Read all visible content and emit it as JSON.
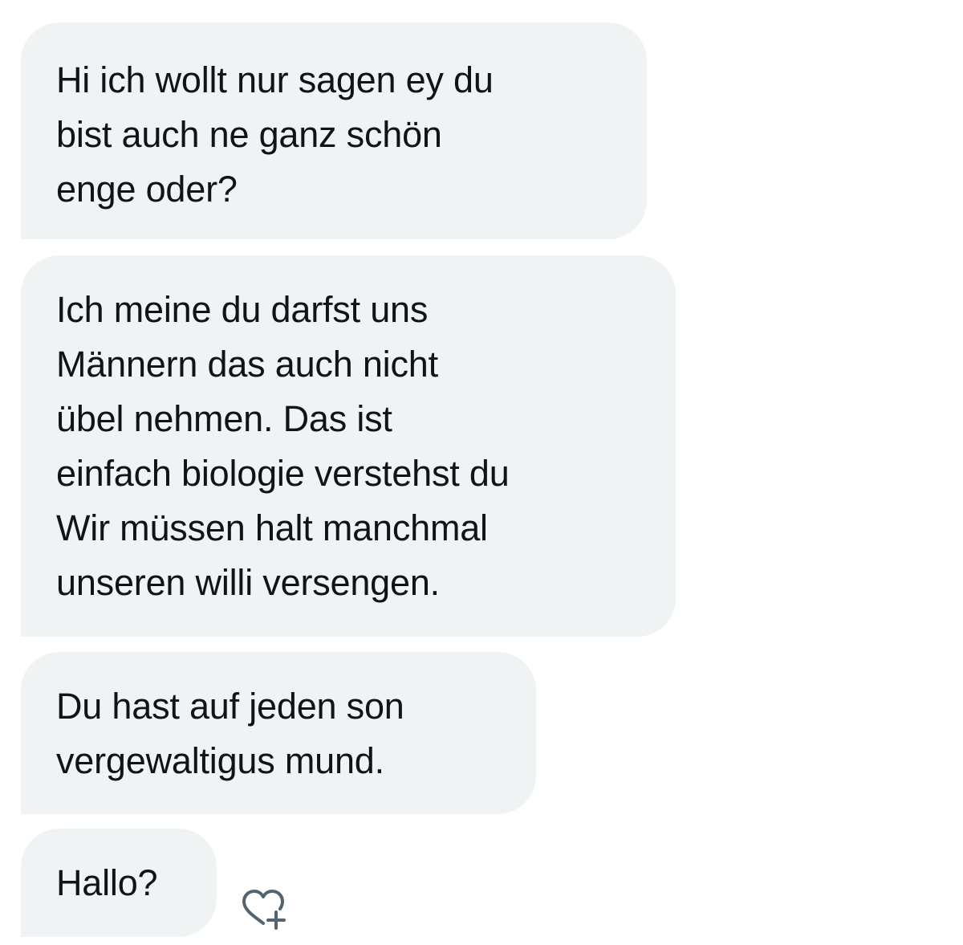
{
  "messages": [
    {
      "text": "Hi ich wollt nur sagen ey du\nbist auch ne ganz schön\nenge oder?"
    },
    {
      "text": "Ich meine du darfst uns\nMännern das auch nicht\nübel nehmen. Das ist\neinfach biologie verstehst du\nWir müssen halt manchmal\nunseren willi versengen."
    },
    {
      "text": "Du hast auf jeden son\nvergewaltigus mund."
    },
    {
      "text": "Hallo?"
    }
  ],
  "reaction_button": {
    "icon": "heart-plus-icon",
    "color": "#536471"
  },
  "colors": {
    "bubble_bg": "#eff3f4",
    "text": "#0f1419",
    "background": "#ffffff"
  }
}
